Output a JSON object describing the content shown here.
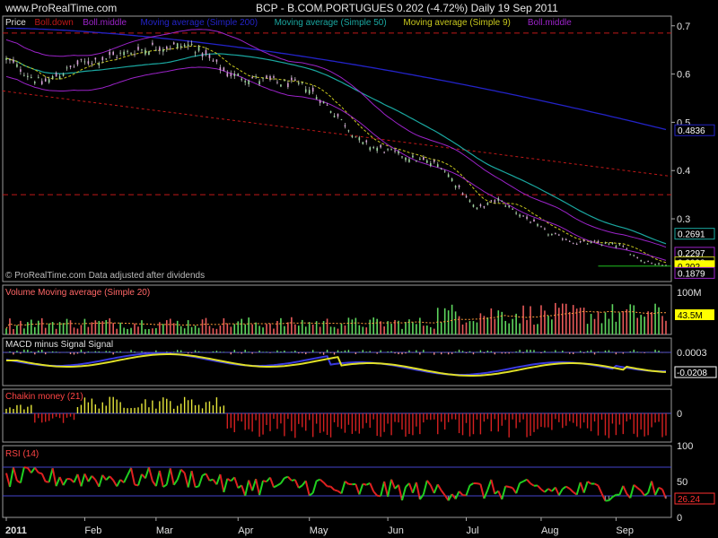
{
  "header": {
    "site": "www.ProRealTime.com",
    "title": "BCP - B.COM.PORTUGUES    0.202 (-4.72%)    Daily  19 Sep 2011"
  },
  "colors": {
    "background": "#000000",
    "panel_border": "#9a9a9a",
    "grid_red": "#c01818",
    "ma200": "#2323c8",
    "ma50": "#1aa7a0",
    "ma9": "#c8c81e",
    "bollinger": "#9b23c8",
    "volume_up": "#5ed65e",
    "volume_down": "#e85a5a",
    "macd_line": "#3a3ae0",
    "signal_line": "#e0e028",
    "chaikin_pos": "#e6e63a",
    "chaikin_neg": "#d42020",
    "rsi_up": "#20d020",
    "rsi_down": "#e02020"
  },
  "chart_data": [
    {
      "type": "candlestick",
      "legend": [
        "Price",
        "Boll.down",
        "Boll.middle",
        "Moving average (Simple 200)",
        "Moving average (Simple 50)",
        "Moving average (Simple 9)",
        "Boll.middle"
      ],
      "note": "© ProRealTime.com Data adjusted after dividends",
      "yticks": [
        "0.7",
        "0.6",
        "0.5",
        "0.4",
        "0.3"
      ],
      "ylim": [
        0.17,
        0.72
      ],
      "x_month_labels": [
        "2011",
        "Feb",
        "Mar",
        "Apr",
        "May",
        "Jun",
        "Jul",
        "Aug",
        "Sep"
      ],
      "last_close": 0.202,
      "change_pct": -4.72,
      "value_tags": [
        {
          "label": "0.4836",
          "value": 0.4836,
          "color": "#2323c8"
        },
        {
          "label": "0.2691",
          "value": 0.2691,
          "color": "#1aa7a0"
        },
        {
          "label": "0.2297",
          "value": 0.2297,
          "color": "#9b23c8"
        },
        {
          "label": "0.2098",
          "value": 0.2098,
          "color": "#c8c81e"
        },
        {
          "label": "0.202",
          "value": 0.202,
          "color": "#ffff00"
        },
        {
          "label": "0.1879",
          "value": 0.1879,
          "color": "#9b23c8"
        }
      ]
    },
    {
      "type": "bar",
      "title": "Volume  Moving average (Simple 20)",
      "yticks": [
        "100M"
      ],
      "value_tag": "43.5M"
    },
    {
      "type": "bar",
      "title": "MACD minus Signal  Signal",
      "value_tags": [
        "0.0003",
        "-0.0208"
      ]
    },
    {
      "type": "bar",
      "title": "Chaikin money (21)",
      "yticks": [
        "0"
      ]
    },
    {
      "type": "line",
      "title": "RSI (14)",
      "yticks": [
        "100",
        "50",
        "0"
      ],
      "levels": [
        30,
        70
      ],
      "value_tag": "26.24"
    }
  ]
}
